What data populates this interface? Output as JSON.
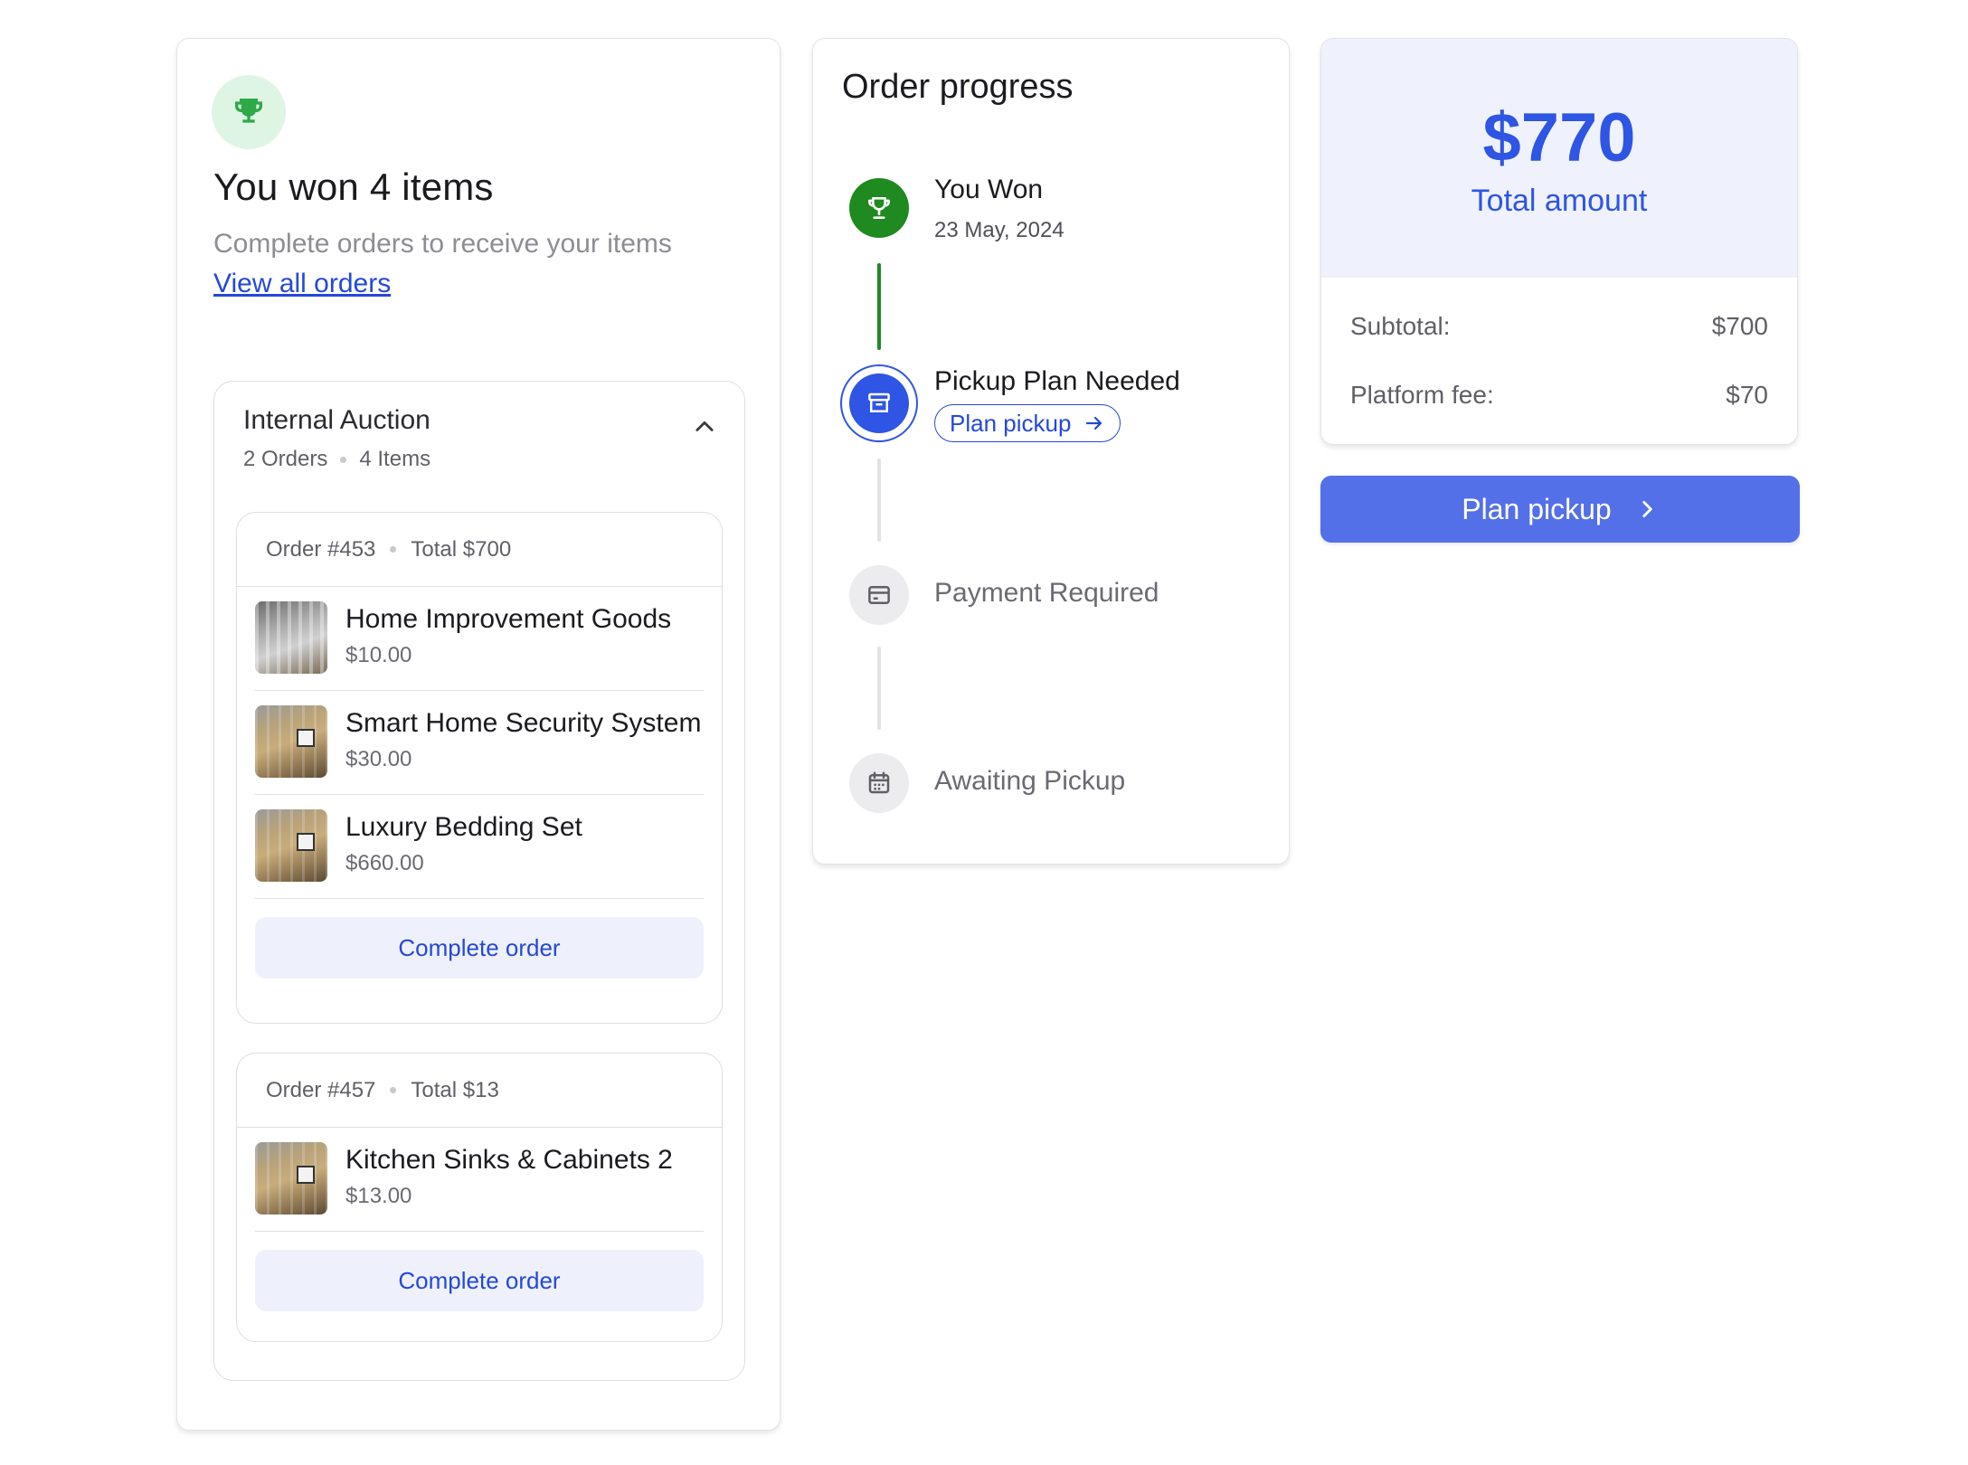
{
  "won": {
    "title": "You won 4 items",
    "subtitle": "Complete orders to receive your items",
    "link": "View all orders",
    "icon": "trophy-icon"
  },
  "auction": {
    "title": "Internal Auction",
    "orders_count": "2 Orders",
    "items_count": "4 Items",
    "orders": [
      {
        "number": "Order #453",
        "total": "Total $700",
        "items": [
          {
            "name": "Home Improvement Goods",
            "price": "$10.00"
          },
          {
            "name": "Smart Home Security System",
            "price": "$30.00"
          },
          {
            "name": "Luxury Bedding Set",
            "price": "$660.00"
          }
        ],
        "button": "Complete order"
      },
      {
        "number": "Order #457",
        "total": "Total $13",
        "items": [
          {
            "name": "Kitchen Sinks & Cabinets 2",
            "price": "$13.00"
          }
        ],
        "button": "Complete order"
      }
    ]
  },
  "progress": {
    "title": "Order progress",
    "steps": [
      {
        "title": "You Won",
        "date": "23 May, 2024",
        "status": "done",
        "icon": "trophy-icon"
      },
      {
        "title": "Pickup Plan Needed",
        "action": "Plan pickup",
        "status": "current",
        "icon": "archive-box-icon"
      },
      {
        "title": "Payment Required",
        "status": "pending",
        "icon": "credit-card-icon"
      },
      {
        "title": "Awaiting Pickup",
        "status": "pending",
        "icon": "calendar-icon"
      }
    ]
  },
  "summary": {
    "total_value": "$770",
    "total_label": "Total amount",
    "subtotal_label": "Subtotal:",
    "subtotal_value": "$700",
    "fee_label": "Platform fee:",
    "fee_value": "$70",
    "button": "Plan pickup"
  },
  "colors": {
    "accent": "#2548d9",
    "accent_button": "#5470e8",
    "success": "#1f8a1f",
    "success_bg": "#dff5e3",
    "muted": "#8d8d94"
  }
}
